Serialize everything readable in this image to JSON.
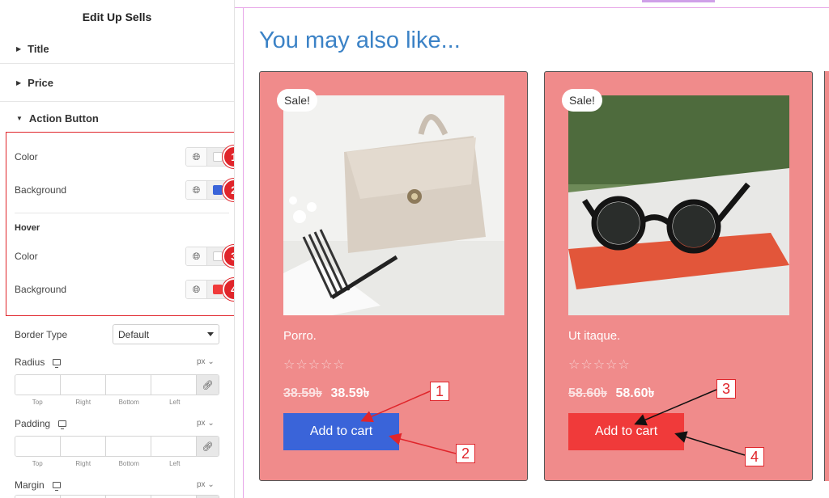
{
  "panel": {
    "title": "Edit Up Sells",
    "sections": {
      "title": "Title",
      "price": "Price",
      "action_button": "Action Button"
    },
    "color_label": "Color",
    "background_label": "Background",
    "hover_label": "Hover",
    "hover_color_label": "Color",
    "hover_background_label": "Background",
    "border_type_label": "Border Type",
    "border_type_value": "Default",
    "radius_label": "Radius",
    "padding_label": "Padding",
    "margin_label": "Margin",
    "unit": "px",
    "dim_labels": [
      "Top",
      "Right",
      "Bottom",
      "Left"
    ],
    "badges": [
      "1",
      "2",
      "3",
      "4"
    ],
    "colors": {
      "color": "#ffffff",
      "background": "#3a64d9",
      "hover_color": "#ffffff",
      "hover_background": "#f03a3a"
    }
  },
  "preview": {
    "heading": "You may also like...",
    "products": [
      {
        "sale": "Sale!",
        "name": "Porro.",
        "stars": "☆☆☆☆☆",
        "old_price": "38.59৳",
        "price": "38.59৳",
        "button": "Add to cart"
      },
      {
        "sale": "Sale!",
        "name": "Ut itaque.",
        "stars": "☆☆☆☆☆",
        "old_price": "58.60৳",
        "price": "58.60৳",
        "button": "Add to cart"
      }
    ],
    "callouts": [
      "1",
      "2",
      "3",
      "4"
    ]
  }
}
